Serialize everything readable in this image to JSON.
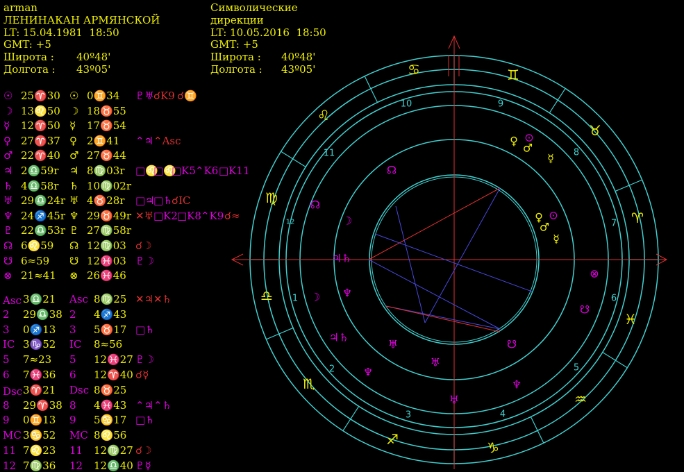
{
  "natal": {
    "name": "arman",
    "place": "ЛЕНИНАКАН АРМЯНСКОЙ",
    "lt": "LT: 15.04.1981  18:50",
    "gmt": "GMT: +5",
    "lat_label": "Широта :",
    "lat_value": "40º48'",
    "lon_label": "Долгота :",
    "lon_value": "43º05'"
  },
  "directions": {
    "title1": "Символические",
    "title2": "дирекции",
    "lt": "LT: 10.05.2016  18:50",
    "gmt": "GMT: +5",
    "lat_label": "Широта :",
    "lat_value": "40º48'",
    "lon_label": "Долгота :",
    "lon_value": "43º05'"
  },
  "planets": [
    {
      "g1": "☉",
      "p1": "25♈30",
      "g2": "☉",
      "p2": "0♊34",
      "aspects": [
        {
          "t": "♇♅",
          "c": "m"
        },
        {
          "t": "☌K9",
          "c": "r"
        },
        {
          "t": "☌♊",
          "c": "r"
        }
      ]
    },
    {
      "g1": "☽",
      "p1": "13♌50",
      "g2": "☽",
      "p2": "18♉55",
      "aspects": []
    },
    {
      "g1": "☿",
      "p1": "12♈50",
      "g2": "☿",
      "p2": "17♉54",
      "aspects": []
    },
    {
      "g1": "♀",
      "p1": "27♈37",
      "g2": "♀",
      "p2": "2♊41",
      "aspects": [
        {
          "t": "⌃♃",
          "c": "m"
        },
        {
          "t": "⌃Asc",
          "c": "r"
        }
      ]
    },
    {
      "g1": "♂",
      "p1": "22♈40",
      "g2": "♂",
      "p2": "27♉44",
      "aspects": []
    },
    {
      "g1": "♃",
      "p1": "2♎59r",
      "g2": "♃",
      "p2": "8♍03r",
      "aspects": [
        {
          "t": "□♌",
          "c": "m"
        },
        {
          "t": "□♌",
          "c": "m"
        },
        {
          "t": "□K5",
          "c": "m"
        },
        {
          "t": "⌃K6",
          "c": "m"
        },
        {
          "t": "□K11",
          "c": "m"
        }
      ]
    },
    {
      "g1": "♄",
      "p1": "4♎58r",
      "g2": "♄",
      "p2": "10♍02r",
      "aspects": []
    },
    {
      "g1": "♅",
      "p1": "29♎24r",
      "g2": "♅",
      "p2": "4♉28r",
      "aspects": [
        {
          "t": "□♃",
          "c": "m"
        },
        {
          "t": "□♄",
          "c": "m"
        },
        {
          "t": "☌IC",
          "c": "r"
        }
      ]
    },
    {
      "g1": "♆",
      "p1": "24♐45r",
      "g2": "♆",
      "p2": "29♉49r",
      "aspects": [
        {
          "t": "✕♅",
          "c": "r"
        },
        {
          "t": "□K2",
          "c": "m"
        },
        {
          "t": "□K8",
          "c": "m"
        },
        {
          "t": "⌃K9",
          "c": "m"
        },
        {
          "t": "☌≈",
          "c": "r"
        }
      ]
    },
    {
      "g1": "♇",
      "p1": "22♎53r",
      "g2": "♇",
      "p2": "27♍58r",
      "aspects": []
    },
    {
      "g1": "☊",
      "p1": "6♌59",
      "g2": "☊",
      "p2": "12♍03",
      "aspects": [
        {
          "t": "☌☽",
          "c": "r"
        }
      ]
    },
    {
      "g1": "☋",
      "p1": "6≈59",
      "g2": "☋",
      "p2": "12♓03",
      "aspects": [
        {
          "t": "♇☽",
          "c": "m"
        }
      ]
    },
    {
      "g1": "⊗",
      "p1": "21≈41",
      "g2": "⊗",
      "p2": "26♓46",
      "aspects": []
    }
  ],
  "houses": [
    {
      "l1": "Asc",
      "p1": "3♎21",
      "l2": "Asc",
      "p2": "8♍25",
      "aspects": [
        {
          "t": "✕♃",
          "c": "r"
        },
        {
          "t": "✕♄",
          "c": "r"
        }
      ]
    },
    {
      "l1": "2",
      "p1": "29♎38",
      "l2": "2",
      "p2": "4♐43",
      "aspects": []
    },
    {
      "l1": "3",
      "p1": "0♐13",
      "l2": "3",
      "p2": "5♉17",
      "aspects": [
        {
          "t": "□♄",
          "c": "m"
        }
      ]
    },
    {
      "l1": "IC",
      "p1": "3♑52",
      "l2": "IC",
      "p2": "8≈56",
      "aspects": []
    },
    {
      "l1": "5",
      "p1": "7≈23",
      "l2": "5",
      "p2": "12♓27",
      "aspects": [
        {
          "t": "♇☽",
          "c": "m"
        }
      ]
    },
    {
      "l1": "6",
      "p1": "7♓36",
      "l2": "6",
      "p2": "12♈40",
      "aspects": [
        {
          "t": "☌☿",
          "c": "r"
        }
      ]
    },
    {
      "l1": "Dsc",
      "p1": "3♈21",
      "l2": "Dsc",
      "p2": "8♉25",
      "aspects": []
    },
    {
      "l1": "8",
      "p1": "29♈38",
      "l2": "8",
      "p2": "4♓43",
      "aspects": [
        {
          "t": "⌃♃",
          "c": "m"
        },
        {
          "t": "⌃♄",
          "c": "m"
        }
      ]
    },
    {
      "l1": "9",
      "p1": "0♊13",
      "l2": "9",
      "p2": "5♋17",
      "aspects": [
        {
          "t": "□♄",
          "c": "m"
        }
      ]
    },
    {
      "l1": "MC",
      "p1": "3♋52",
      "l2": "MC",
      "p2": "8♌56",
      "aspects": []
    },
    {
      "l1": "11",
      "p1": "7♌23",
      "l2": "11",
      "p2": "12♍27",
      "aspects": [
        {
          "t": "☌☽",
          "c": "r"
        }
      ]
    },
    {
      "l1": "12",
      "p1": "7♍36",
      "l2": "12",
      "p2": "12♎40",
      "aspects": [
        {
          "t": "♇☿",
          "c": "m"
        }
      ]
    }
  ],
  "wheel": {
    "zodiac": [
      "♋",
      "♊",
      "♉",
      "♈",
      "♓",
      "♒",
      "♑",
      "♐",
      "♏",
      "♎",
      "♍",
      "♌"
    ],
    "house_numbers": [
      "1",
      "2",
      "3",
      "4",
      "5",
      "6",
      "7",
      "8",
      "9",
      "10",
      "11",
      "12"
    ],
    "inner_glyphs": [
      "☊",
      "☊",
      "☽",
      "♃♄",
      "☽",
      "♆",
      "♃♄",
      "♅",
      "♆",
      "♅",
      "♆",
      "♅",
      "☋",
      "⊗",
      "☋",
      "☿",
      "♀",
      "♂",
      "⊙",
      "♀",
      "♂",
      "⊙",
      "☿"
    ],
    "colors": {
      "ring": "#40d0d0",
      "axis": "#e03030",
      "aspect_blue": "#4848e0",
      "aspect_red": "#e03030",
      "planet": "#e000e0",
      "outer": "#f0f000"
    }
  }
}
